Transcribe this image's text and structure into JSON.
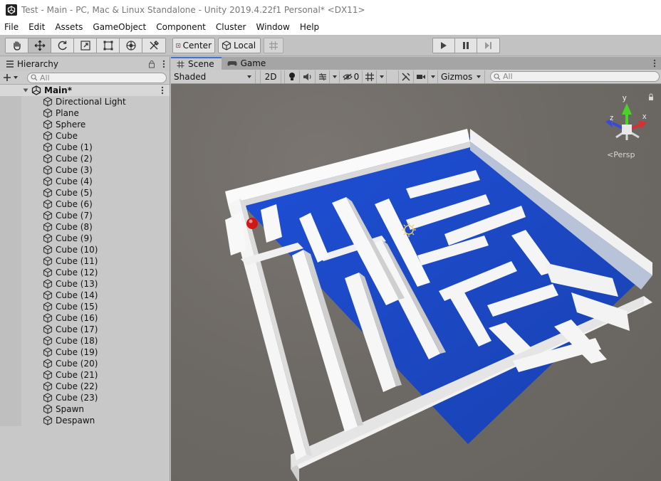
{
  "window": {
    "title": "Test - Main - PC, Mac & Linux Standalone - Unity 2019.4.22f1 Personal* <DX11>"
  },
  "menu": [
    "File",
    "Edit",
    "Assets",
    "GameObject",
    "Component",
    "Cluster",
    "Window",
    "Help"
  ],
  "toolbar": {
    "tools": [
      "hand-tool-icon",
      "move-tool-icon",
      "rotate-tool-icon",
      "scale-tool-icon",
      "rect-tool-icon",
      "transform-tool-icon",
      "custom-tool-icon"
    ],
    "pivot_label": "Center",
    "space_label": "Local"
  },
  "hierarchy": {
    "tab_label": "Hierarchy",
    "search_placeholder": "All",
    "scene_name": "Main*",
    "items": [
      "Directional Light",
      "Plane",
      "Sphere",
      "Cube",
      "Cube (1)",
      "Cube (2)",
      "Cube (3)",
      "Cube (4)",
      "Cube (5)",
      "Cube (6)",
      "Cube (7)",
      "Cube (8)",
      "Cube (9)",
      "Cube (10)",
      "Cube (11)",
      "Cube (12)",
      "Cube (13)",
      "Cube (14)",
      "Cube (15)",
      "Cube (16)",
      "Cube (17)",
      "Cube (18)",
      "Cube (19)",
      "Cube (20)",
      "Cube (21)",
      "Cube (22)",
      "Cube (23)",
      "Spawn",
      "Despawn"
    ]
  },
  "scene": {
    "tab_scene": "Scene",
    "tab_game": "Game",
    "shading_mode": "Shaded",
    "mode_2d": "2D",
    "hidden_count": "0",
    "gizmos_label": "Gizmos",
    "search_placeholder": "All",
    "projection_label": "Persp",
    "axis_labels": {
      "x": "x",
      "y": "y",
      "z": "z"
    }
  },
  "colors": {
    "floor_blue": "#1e4fd6",
    "wall_white": "#f0f0f0",
    "ball_red": "#d01818",
    "tab_accent": "#3a72d8"
  }
}
